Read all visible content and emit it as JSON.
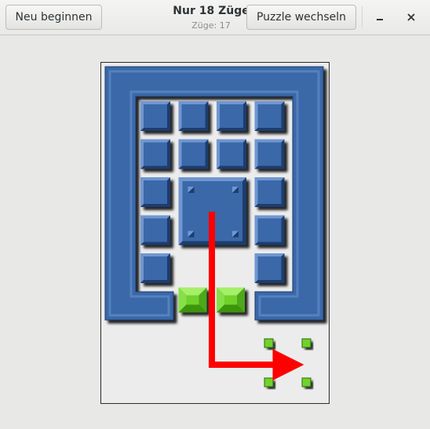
{
  "header": {
    "restart_label": "Neu beginnen",
    "title": "Nur 18 Züge",
    "subtitle": "Züge: 17",
    "change_puzzle_label": "Puzzle wechseln",
    "minimize_icon": "minimize-icon",
    "close_icon": "close-icon"
  },
  "board": {
    "grid_cols": 5,
    "grid_rows": 8,
    "small_blocks": [
      [
        0,
        0
      ],
      [
        1,
        0
      ],
      [
        2,
        0
      ],
      [
        3,
        0
      ],
      [
        0,
        1
      ],
      [
        1,
        1
      ],
      [
        2,
        1
      ],
      [
        3,
        1
      ],
      [
        0,
        2
      ],
      [
        3,
        2
      ],
      [
        0,
        3
      ],
      [
        3,
        3
      ],
      [
        0,
        4
      ],
      [
        3,
        4
      ]
    ],
    "big_block": [
      1,
      2
    ],
    "green_blocks": [
      [
        1,
        5
      ],
      [
        2,
        5
      ]
    ],
    "target_markers": [
      [
        3,
        7
      ],
      [
        4,
        7
      ],
      [
        3,
        8
      ],
      [
        4,
        8
      ]
    ],
    "move_hint": "arrow-down-right",
    "colors": {
      "block": "#3a67a8",
      "block_light": "#6f97d2",
      "block_dark": "#1e3d6e",
      "green": "#6fd22a",
      "arrow": "#ff0000",
      "background": "#ececec"
    }
  }
}
